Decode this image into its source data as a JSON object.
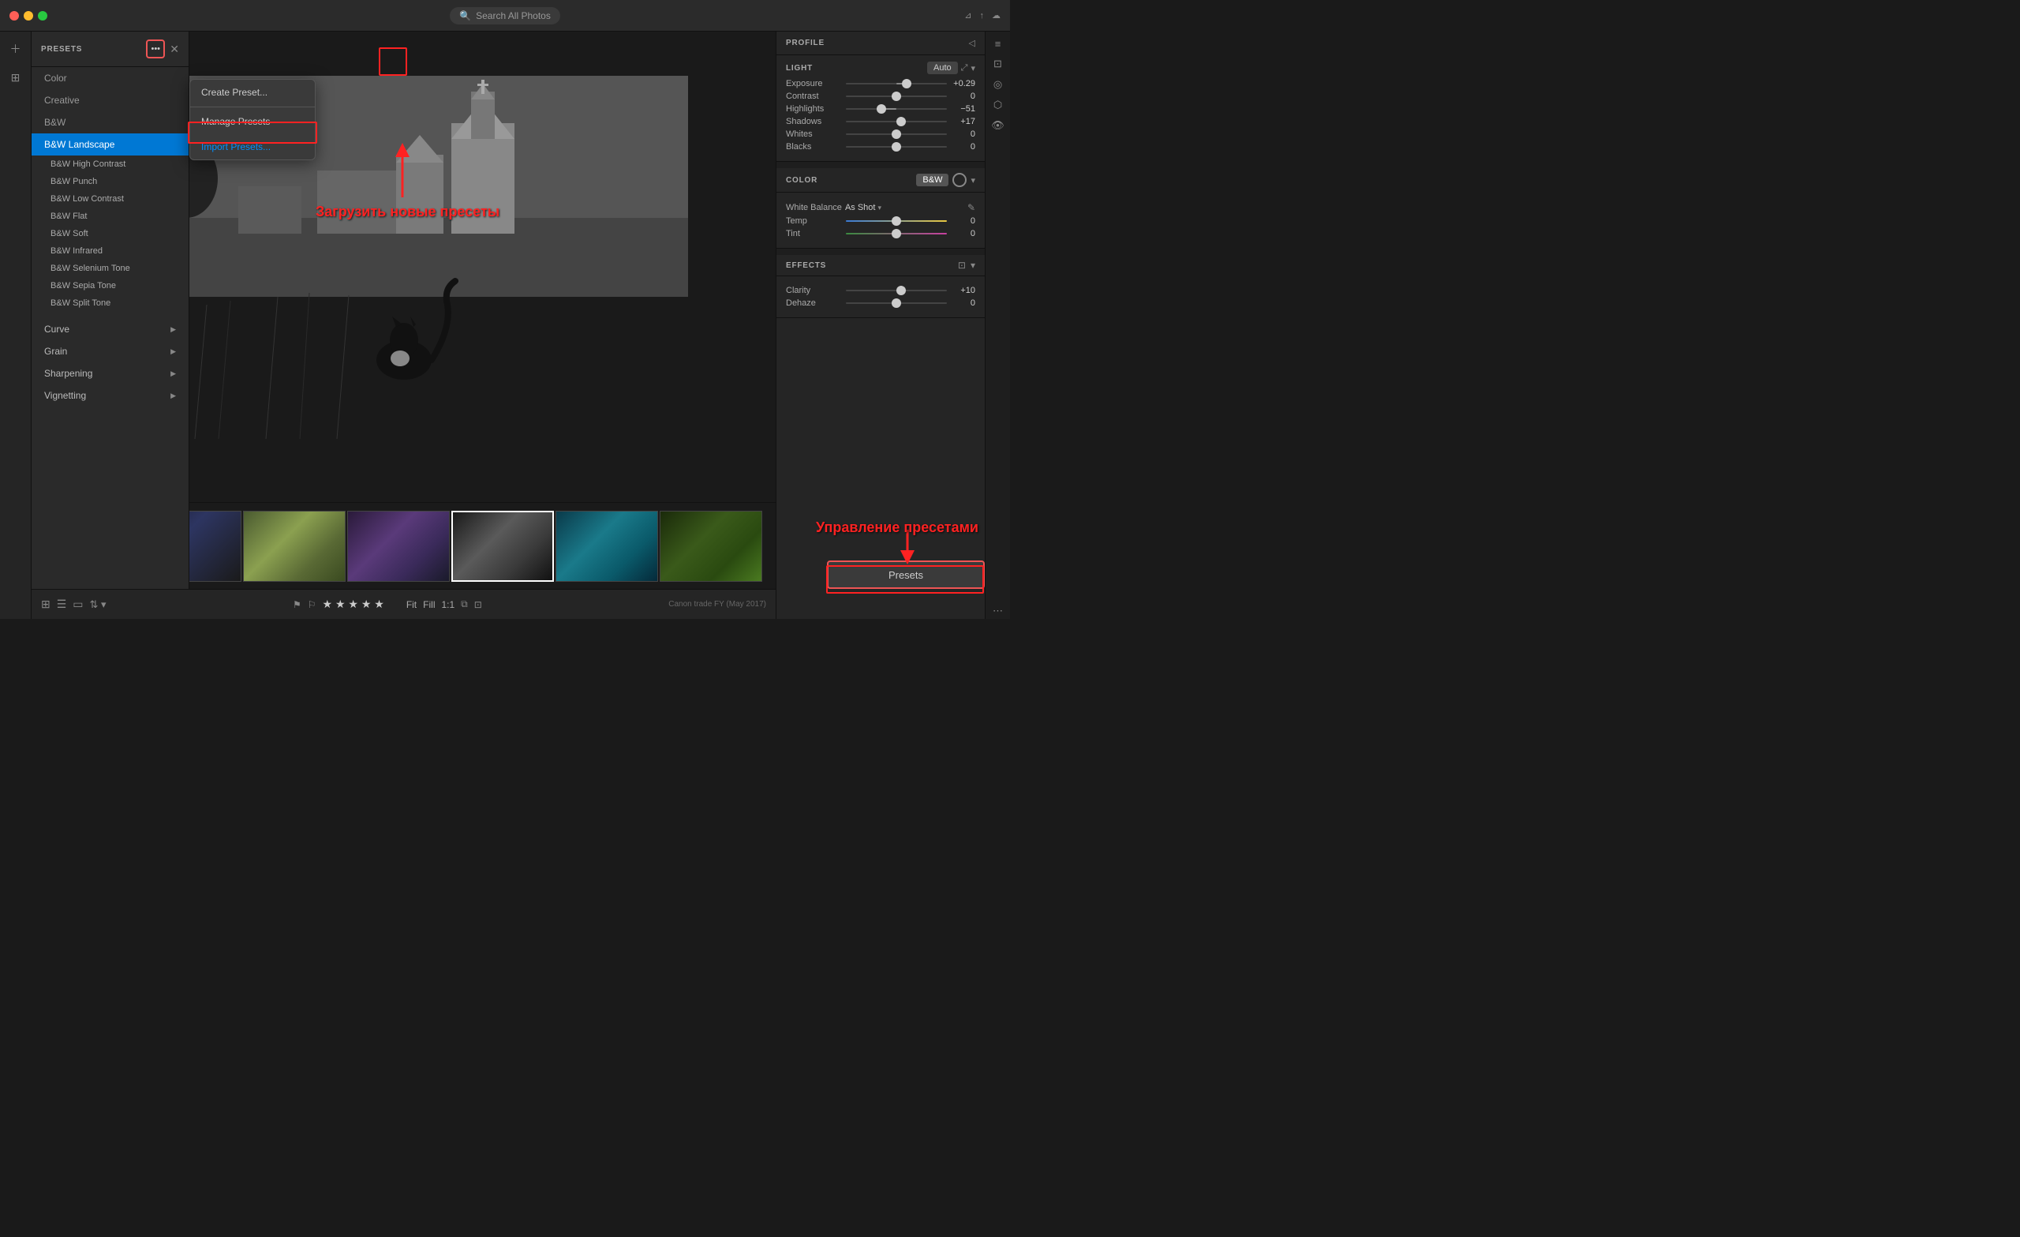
{
  "titleBar": {
    "searchPlaceholder": "Search All Photos"
  },
  "presets": {
    "title": "PRESETS",
    "items": [
      {
        "label": "Color",
        "type": "category"
      },
      {
        "label": "Creative",
        "type": "category"
      },
      {
        "label": "B&W",
        "type": "category"
      },
      {
        "label": "B&W Landscape",
        "type": "selected"
      },
      {
        "label": "B&W High Contrast",
        "type": "sub"
      },
      {
        "label": "B&W Punch",
        "type": "sub"
      },
      {
        "label": "B&W Low Contrast",
        "type": "sub"
      },
      {
        "label": "B&W Flat",
        "type": "sub"
      },
      {
        "label": "B&W Soft",
        "type": "sub"
      },
      {
        "label": "B&W Infrared",
        "type": "sub"
      },
      {
        "label": "B&W Selenium Tone",
        "type": "sub"
      },
      {
        "label": "B&W Sepia Tone",
        "type": "sub"
      },
      {
        "label": "B&W Split Tone",
        "type": "sub"
      }
    ],
    "collapsibles": [
      {
        "label": "Curve"
      },
      {
        "label": "Grain"
      },
      {
        "label": "Sharpening"
      },
      {
        "label": "Vignetting"
      }
    ]
  },
  "dropdown": {
    "items": [
      {
        "label": "Create Preset...",
        "type": "normal"
      },
      {
        "label": "Manage Presets",
        "type": "normal"
      },
      {
        "label": "Import Presets...",
        "type": "highlighted"
      }
    ]
  },
  "profile": {
    "title": "PROFILE",
    "arrow": "◁"
  },
  "light": {
    "title": "LIGHT",
    "autoLabel": "Auto",
    "sliders": [
      {
        "label": "Exposure",
        "value": "+0.29",
        "percent": 60
      },
      {
        "label": "Contrast",
        "value": "0",
        "percent": 50
      },
      {
        "label": "Highlights",
        "value": "-51",
        "percent": 35
      },
      {
        "label": "Shadows",
        "value": "+17",
        "percent": 55
      },
      {
        "label": "Whites",
        "value": "0",
        "percent": 50
      },
      {
        "label": "Blacks",
        "value": "0",
        "percent": 50
      }
    ]
  },
  "color": {
    "title": "COLOR",
    "bwLabel": "B&W",
    "whiteBalanceLabel": "White Balance",
    "whiteBalanceValue": "As Shot",
    "tempLabel": "Temp",
    "tempValue": "0",
    "tintLabel": "Tint",
    "tintValue": "0"
  },
  "effects": {
    "title": "EFFECTS",
    "clarityLabel": "Clarity",
    "clarityValue": "+10",
    "dehazeLabel": "Dehaze",
    "dehazeValue": "0"
  },
  "bottomBar": {
    "fitLabel": "Fit",
    "fillLabel": "Fill",
    "oneToOneLabel": "1:1",
    "stars": [
      "★",
      "★",
      "★",
      "★",
      "★"
    ]
  },
  "presetsBtn": {
    "label": "Presets"
  },
  "annotations": {
    "importText": "Загрузить новые пресеты",
    "manageText": "Управление пресетами"
  },
  "thumbs": [
    {
      "class": "thumb-orange"
    },
    {
      "class": "thumb-dark"
    },
    {
      "class": "thumb-landscape"
    },
    {
      "class": "thumb-purple"
    },
    {
      "class": "thumb-bw",
      "selected": true
    },
    {
      "class": "thumb-teal"
    },
    {
      "class": "thumb-nature"
    }
  ]
}
